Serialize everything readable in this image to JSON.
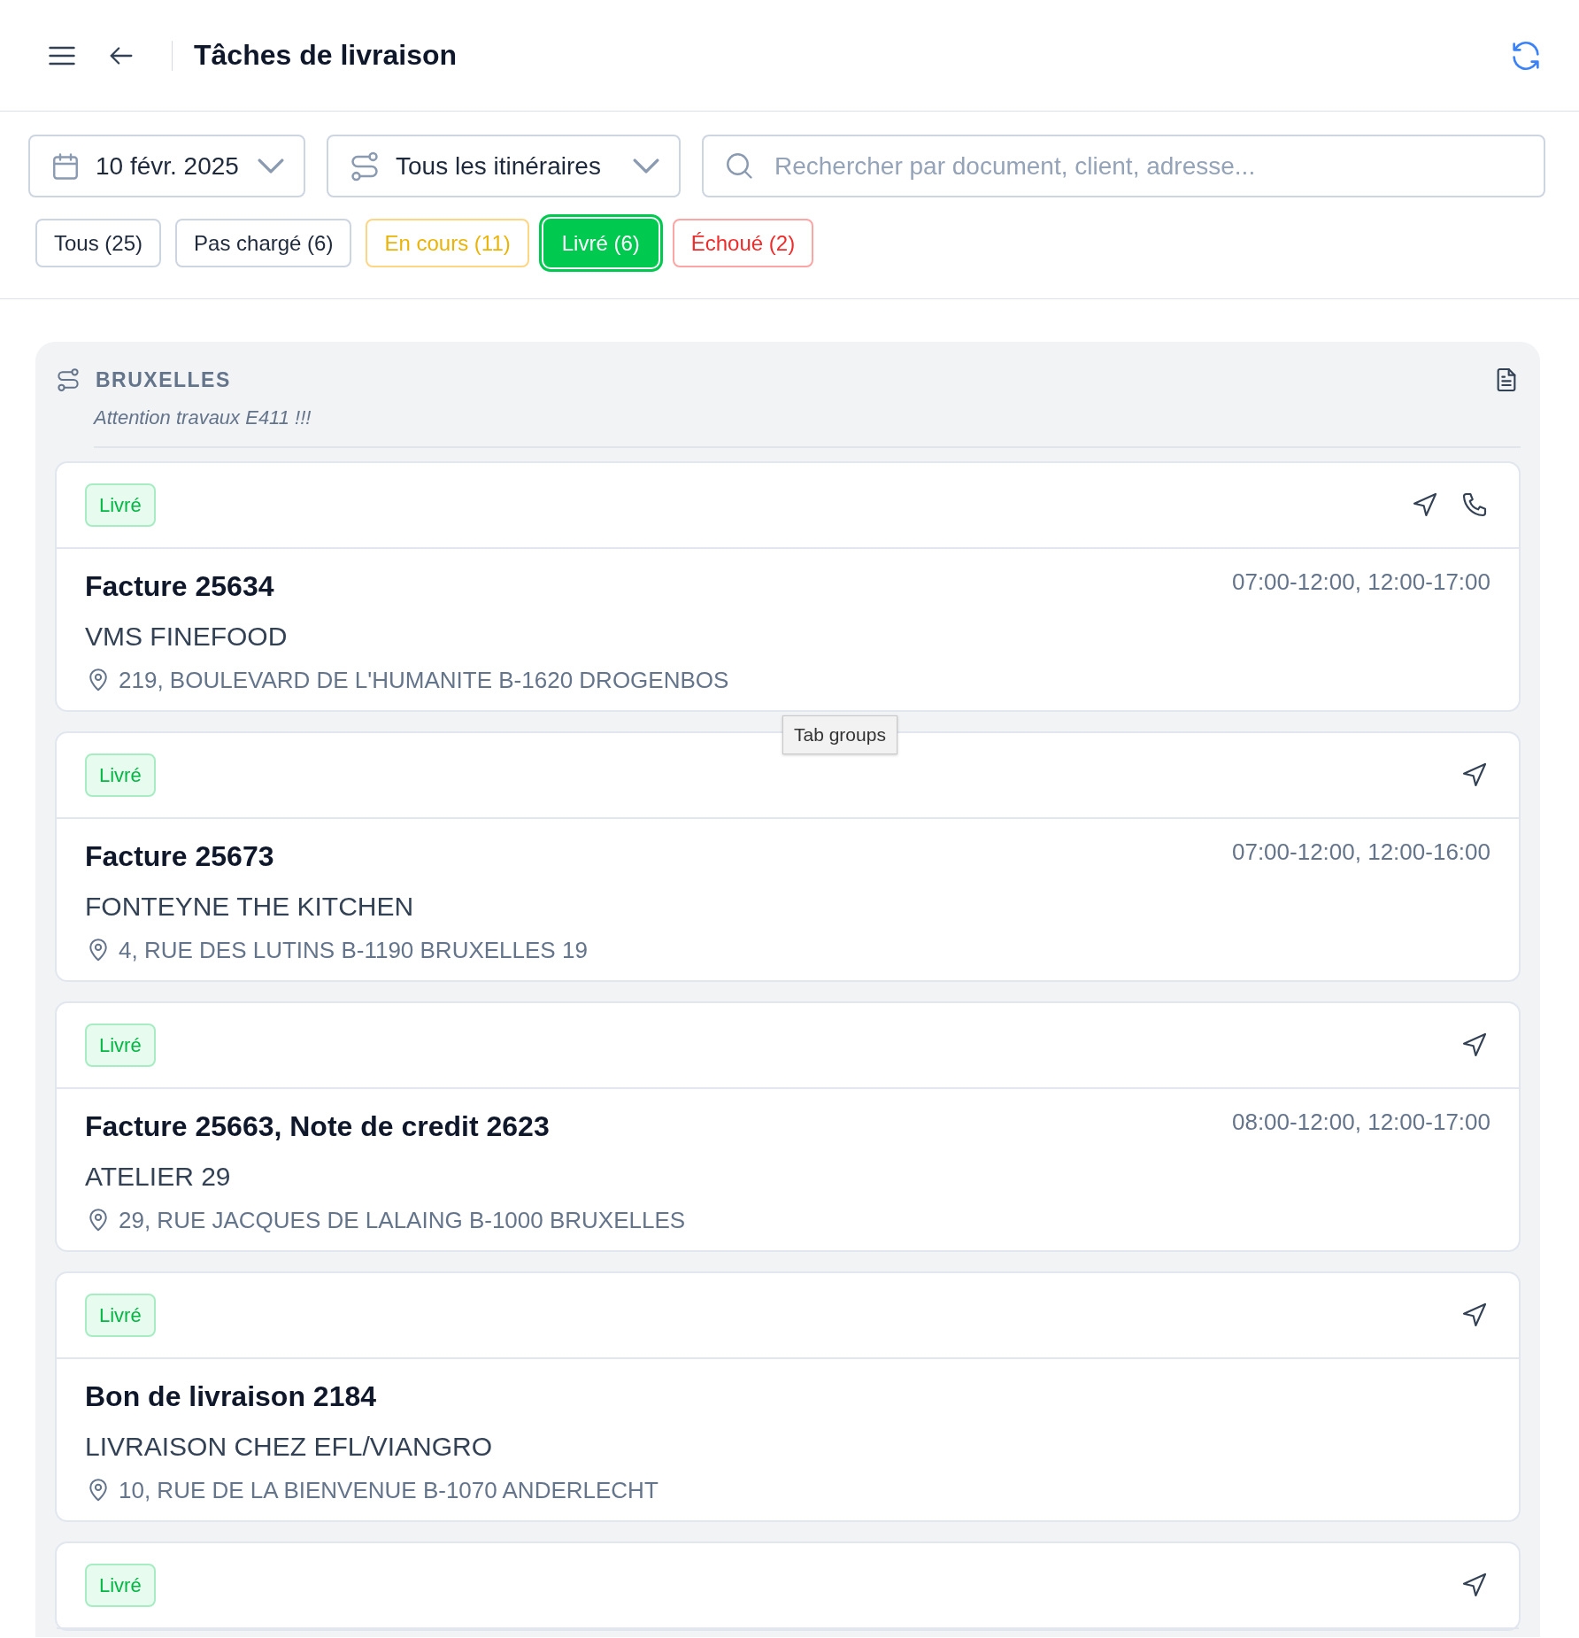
{
  "header": {
    "title": "Tâches de livraison"
  },
  "filters": {
    "date": "10 févr. 2025",
    "route": "Tous les itinéraires",
    "search": {
      "placeholder": "Rechercher par document, client, adresse..."
    }
  },
  "status_tabs": [
    {
      "label": "Tous (25)",
      "kind": "all",
      "selected": false
    },
    {
      "label": "Pas chargé (6)",
      "kind": "pending",
      "selected": false
    },
    {
      "label": "En cours (11)",
      "kind": "progress",
      "selected": false
    },
    {
      "label": "Livré (6)",
      "kind": "delivered",
      "selected": true
    },
    {
      "label": "Échoué (2)",
      "kind": "failed",
      "selected": false
    }
  ],
  "group": {
    "name": "BRUXELLES",
    "note": "Attention travaux E411 !!!",
    "tasks": [
      {
        "status": "Livré",
        "phone": true,
        "documents": "Facture 25634",
        "time_windows": "07:00-12:00, 12:00-17:00",
        "customer": "VMS FINEFOOD",
        "address": "219, BOULEVARD DE L'HUMANITE B-1620 DROGENBOS"
      },
      {
        "status": "Livré",
        "phone": false,
        "documents": "Facture 25673",
        "time_windows": "07:00-12:00, 12:00-16:00",
        "customer": "FONTEYNE THE KITCHEN",
        "address": "4, RUE DES LUTINS B-1190 BRUXELLES 19"
      },
      {
        "status": "Livré",
        "phone": false,
        "documents": "Facture 25663, Note de credit 2623",
        "time_windows": "08:00-12:00, 12:00-17:00",
        "customer": "ATELIER 29",
        "address": "29, RUE JACQUES DE LALAING B-1000 BRUXELLES"
      },
      {
        "status": "Livré",
        "phone": false,
        "documents": "Bon de livraison 2184",
        "customer": "LIVRAISON CHEZ EFL/VIANGRO",
        "address": "10, RUE DE LA BIENVENUE B-1070 ANDERLECHT"
      },
      {
        "status": "Livré",
        "phone": false
      }
    ]
  },
  "tooltip": "Tab groups"
}
